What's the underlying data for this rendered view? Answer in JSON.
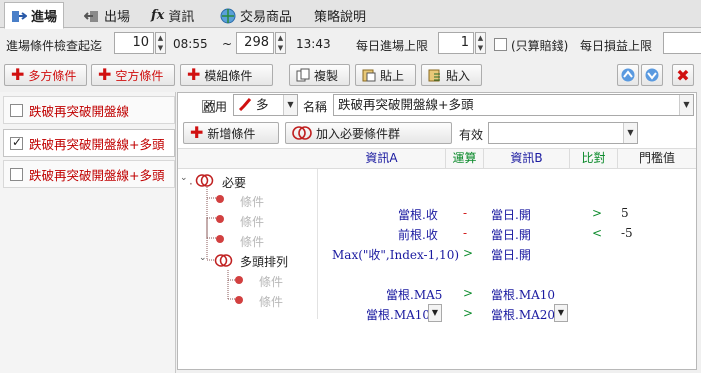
{
  "tabs": [
    {
      "label": "進場",
      "icon": "entry-icon",
      "active": true
    },
    {
      "label": "出場",
      "icon": "exit-icon",
      "active": false
    },
    {
      "label": "資訊",
      "icon": "fx-icon",
      "active": false
    },
    {
      "label": "交易商品",
      "icon": "globe-icon",
      "active": false
    },
    {
      "label": "策略說明",
      "icon": "",
      "active": false
    }
  ],
  "check_range": {
    "label": "進場條件檢查起迄",
    "from_value": "10",
    "from_time": "08:55",
    "separator": "~",
    "to_value": "298",
    "to_time": "13:43"
  },
  "daily_limit": {
    "label": "每日進場上限",
    "value": "1",
    "loss_only_label": "(只算賠錢)",
    "daily_loss_label": "每日損益上限"
  },
  "toolbar": {
    "long_cond": "多方條件",
    "short_cond": "空方條件",
    "module_cond": "模組條件",
    "copy": "複製",
    "paste_up": "貼上",
    "paste_in": "貼入"
  },
  "left_list": [
    {
      "label": "跌破再突破開盤線",
      "checked": false
    },
    {
      "label": "跌破再突破開盤線+多頭",
      "checked": true
    },
    {
      "label": "跌破再突破開盤線+多頭",
      "checked": false
    }
  ],
  "detail": {
    "enable_label": "啟用",
    "direction": "多",
    "name_label": "名稱",
    "name_value": "跌破再突破開盤線+多頭",
    "add_cond": "新增條件",
    "add_group": "加入必要條件群",
    "valid_label": "有效",
    "valid_value": ""
  },
  "columns": {
    "a": "資訊A",
    "op": "運算",
    "b": "資訊B",
    "cmp": "比對",
    "threshold": "門檻值"
  },
  "tree": {
    "group1": "必要",
    "group2": "多頭排列",
    "cond_label": "條件"
  },
  "rows": [
    {
      "a": "當根.收",
      "op": "-",
      "b": "當日.開",
      "cmp": ">",
      "threshold": "5"
    },
    {
      "a": "前根.收",
      "op": "-",
      "b": "當日.開",
      "cmp": "<",
      "threshold": "-5"
    },
    {
      "a": "Max(\"收\",Index-1,10)",
      "op": ">",
      "b": "當日.開",
      "cmp": "",
      "threshold": ""
    },
    {
      "a": "當根.MA5",
      "op": ">",
      "b": "當根.MA10",
      "cmp": "",
      "threshold": ""
    },
    {
      "a": "當根.MA10",
      "op": ">",
      "b": "當根.MA20",
      "cmp": "",
      "threshold": ""
    }
  ],
  "colors": {
    "accent_red": "#d01010",
    "link_blue": "#1a1aa0",
    "op_green": "#0a8a2a"
  }
}
